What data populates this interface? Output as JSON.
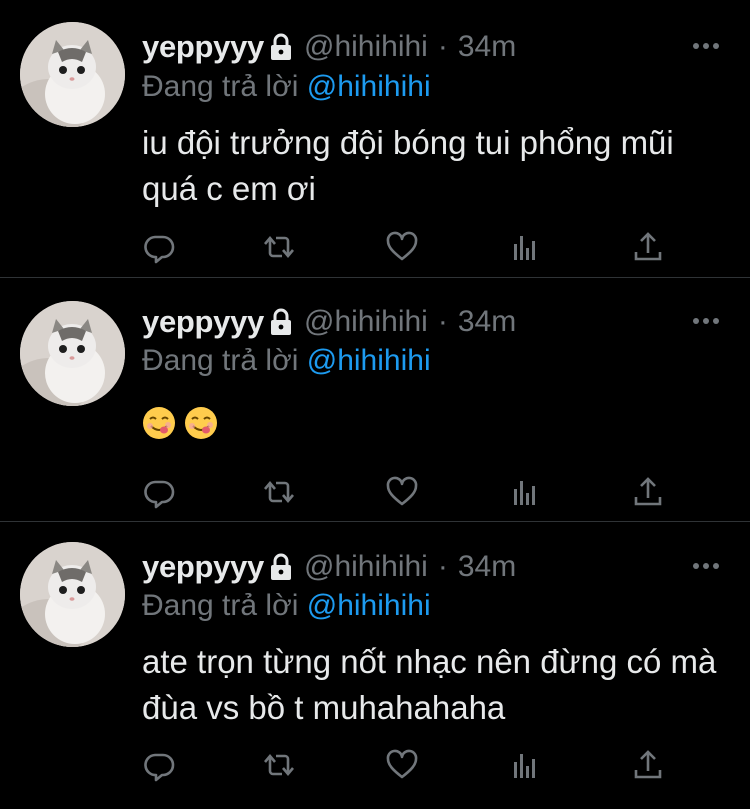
{
  "colors": {
    "background": "#000000",
    "divider": "#2f3336",
    "name": "#e7e9ea",
    "muted": "#71767b",
    "link": "#1d9bf0"
  },
  "tweets": [
    {
      "name": "yeppyyy",
      "handle": "@hihihihi",
      "separator": "·",
      "time": "34m",
      "reply_prefix": "Đang trả lời",
      "reply_to": "@hihihihi",
      "text": "iu đội trưởng đội bóng tui phổng mũi quá c em ơi",
      "emojis": []
    },
    {
      "name": "yeppyyy",
      "handle": "@hihihihi",
      "separator": "·",
      "time": "34m",
      "reply_prefix": "Đang trả lời",
      "reply_to": "@hihihihi",
      "text": "",
      "emojis": [
        "yum-face-emoji",
        "yum-face-emoji"
      ]
    },
    {
      "name": "yeppyyy",
      "handle": "@hihihihi",
      "separator": "·",
      "time": "34m",
      "reply_prefix": "Đang trả lời",
      "reply_to": "@hihihihi",
      "text": "ate trọn từng nốt nhạc nên đừng có mà đùa vs bồ t muhahahaha",
      "emojis": []
    }
  ],
  "icons": {
    "protected": "lock-icon",
    "more": "more-horizontal-icon",
    "reply": "reply-icon",
    "retweet": "retweet-icon",
    "like": "heart-icon",
    "views": "analytics-icon",
    "share": "share-icon"
  }
}
